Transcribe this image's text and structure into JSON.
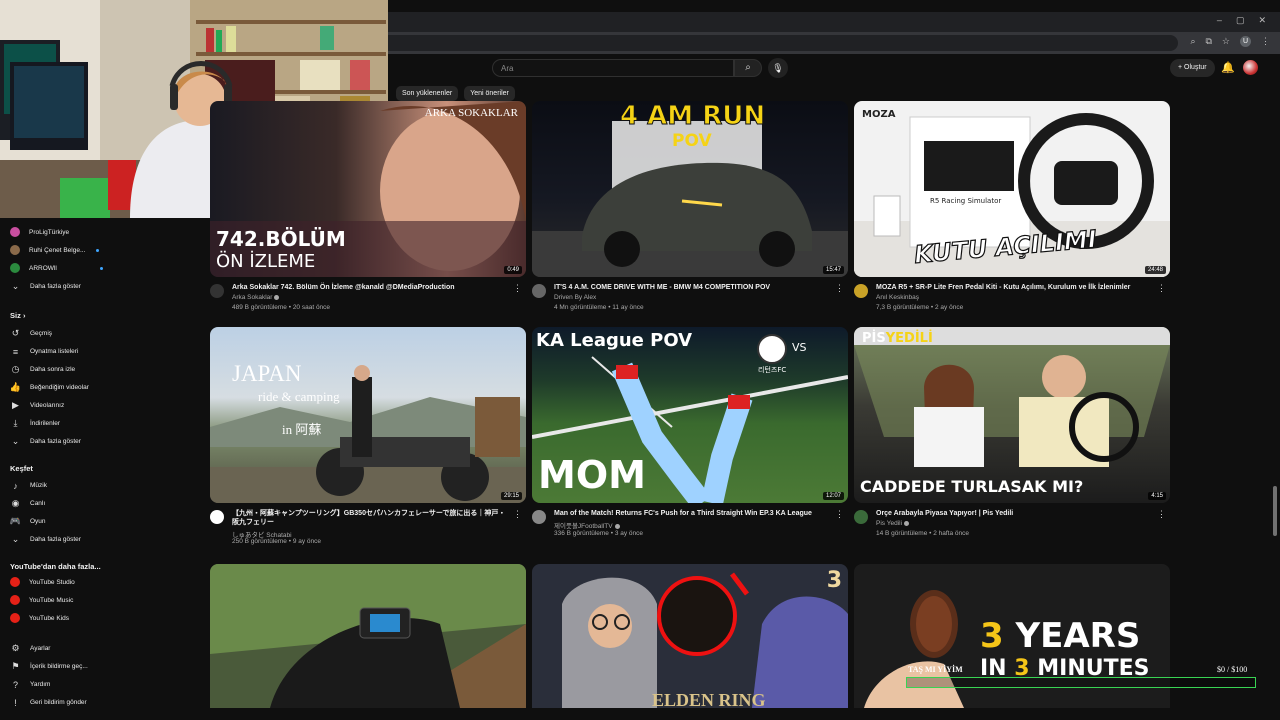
{
  "browser": {
    "controls": [
      "–",
      "▢",
      "✕"
    ],
    "profile_initial": "U"
  },
  "header": {
    "search_placeholder": "Ara",
    "create_label": "Oluştur"
  },
  "chips": [
    "Son yüklenenler",
    "Yeni öneriler"
  ],
  "sidebar": {
    "subscriptions": [
      {
        "label": "ProLigTürkiye",
        "color": "#c94fa0",
        "live": false
      },
      {
        "label": "Ruhi Çenet Belge...",
        "color": "#8a6a4a",
        "live": true
      },
      {
        "label": "ARROWll",
        "color": "#2b8a3e",
        "live": true
      }
    ],
    "subs_more": "Daha fazla göster",
    "you_heading": "Siz",
    "you_items": [
      {
        "label": "Geçmiş",
        "icon": "history-icon",
        "glyph": "↺"
      },
      {
        "label": "Oynatma listeleri",
        "icon": "playlist-icon",
        "glyph": "≡"
      },
      {
        "label": "Daha sonra izle",
        "icon": "clock-icon",
        "glyph": "◷"
      },
      {
        "label": "Beğendiğim videolar",
        "icon": "thumbs-up-icon",
        "glyph": "👍"
      },
      {
        "label": "Videolarınız",
        "icon": "video-icon",
        "glyph": "▶"
      },
      {
        "label": "İndirilenler",
        "icon": "download-icon",
        "glyph": "⤓"
      },
      {
        "label": "Daha fazla göster",
        "icon": "chevron-down-icon",
        "glyph": "⌄"
      }
    ],
    "explore_heading": "Keşfet",
    "explore_items": [
      {
        "label": "Müzik",
        "icon": "music-icon",
        "glyph": "♪"
      },
      {
        "label": "Canlı",
        "icon": "live-icon",
        "glyph": "◉"
      },
      {
        "label": "Oyun",
        "icon": "gamepad-icon",
        "glyph": "🎮"
      },
      {
        "label": "Daha fazla göster",
        "icon": "chevron-down-icon",
        "glyph": "⌄"
      }
    ],
    "more_heading": "YouTube'dan daha fazla...",
    "more_items": [
      "YouTube Studio",
      "YouTube Music",
      "YouTube Kids"
    ],
    "settings_items": [
      {
        "label": "Ayarlar",
        "icon": "gear-icon",
        "glyph": "⚙"
      },
      {
        "label": "İçerik bildirme geç...",
        "icon": "flag-icon",
        "glyph": "⚑"
      },
      {
        "label": "Yardım",
        "icon": "help-icon",
        "glyph": "?"
      },
      {
        "label": "Geri bildirim gönder",
        "icon": "feedback-icon",
        "glyph": "!"
      }
    ]
  },
  "videos": [
    {
      "title": "Arka Sokaklar 742. Bölüm Ön İzleme @kanald @DMediaProduction",
      "channel": "Arka Sokaklar",
      "verified": true,
      "stats": "489 B görüntüleme • 20 saat önce",
      "duration": "0:49",
      "overlay": [
        "ARKA SOKAKLAR",
        "742.BÖLÜM",
        "ÖN İZLEME"
      ]
    },
    {
      "title": "IT'S 4 A.M. COME DRIVE WITH ME - BMW M4 COMPETITION POV",
      "channel": "Driven By Alex",
      "verified": false,
      "stats": "4 Mn görüntüleme • 11 ay önce",
      "duration": "15:47",
      "overlay": [
        "4 AM RUN",
        "POV"
      ]
    },
    {
      "title": "MOZA R5 + SR-P Lite Fren Pedal Kiti - Kutu Açılımı, Kurulum ve İlk İzlenimler",
      "channel": "Anıl Keskinbaş",
      "verified": false,
      "stats": "7,3 B görüntüleme • 2 ay önce",
      "duration": "24:48",
      "overlay": [
        "MOZA",
        "R5 Racing Simulator",
        "KUTU AÇILIMI"
      ]
    },
    {
      "title": "【九州・阿蘇キャンプツーリング】GB350セパハンカフェレーサーで旅に出る｜神戸・阪九フェリー",
      "channel": "しゅあタビ Schatabi",
      "verified": false,
      "stats": "250 B görüntüleme • 9 ay önce",
      "duration": "29:15",
      "overlay": [
        "JAPAN",
        "ride & camping",
        "in 阿蘇"
      ]
    },
    {
      "title": "Man of the Match! Returns FC's Push for a Third Straight Win EP.3 KA League",
      "channel": "제이풋볼JFootballTV",
      "verified": true,
      "stats": "336 B görüntüleme • 3 ay önce",
      "duration": "12:07",
      "overlay": [
        "KA League POV",
        "MOM",
        "VS",
        "리턴즈FC"
      ]
    },
    {
      "title": "Orçe Arabayla Piyasa Yapıyor! | Pis Yedili",
      "channel": "Pis Yedili",
      "verified": true,
      "stats": "14 B görüntüleme • 2 hafta önce",
      "duration": "4:15",
      "overlay": [
        "PİS",
        "YEDİLİ",
        "CADDEDE TURLASAK MI?"
      ]
    },
    {
      "overlay": []
    },
    {
      "overlay": [
        "3",
        "ELDEN RING"
      ]
    },
    {
      "overlay": [
        "3",
        "YEARS",
        "IN",
        "3",
        "MINUTES"
      ]
    }
  ],
  "goal": {
    "label": "TAŞ MI YİYİM",
    "current": "$0",
    "target": "/ $100",
    "progress": 0
  }
}
